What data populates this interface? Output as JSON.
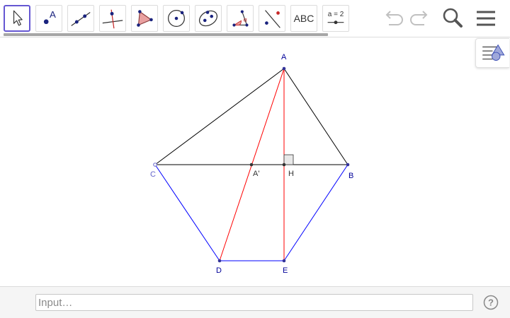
{
  "toolbar": {
    "tools": [
      {
        "name": "move-tool",
        "active": true
      },
      {
        "name": "point-tool",
        "icon_label": "A"
      },
      {
        "name": "line-tool"
      },
      {
        "name": "perpendicular-line-tool"
      },
      {
        "name": "polygon-tool"
      },
      {
        "name": "circle-with-center-tool"
      },
      {
        "name": "ellipse-tool"
      },
      {
        "name": "angle-tool",
        "icon_label": "α"
      },
      {
        "name": "reflect-about-line-tool"
      },
      {
        "name": "text-tool",
        "icon_label": "ABC"
      },
      {
        "name": "slider-tool",
        "icon_label": "a = 2"
      }
    ],
    "right_buttons": [
      "undo-icon",
      "redo-icon",
      "search-icon",
      "menu-icon"
    ]
  },
  "canvas": {
    "points": {
      "A": "A",
      "B": "B",
      "C": "C",
      "D": "D",
      "E": "E",
      "H": "H",
      "A_prime": "A'"
    },
    "colors": {
      "black_segments": "#000000",
      "blue_segments": "#0000ff",
      "red_segments": "#ff0000",
      "point_fill": "#333399",
      "label_dark_blue": "#000099",
      "label_violet": "#6666cc",
      "label_dark": "#333333"
    }
  },
  "input_bar": {
    "placeholder": "Input…"
  },
  "colors": {
    "active_tool_border": "#6557d2",
    "polygon_fill": "#e9a0a0",
    "icon_blue": "#1a237e"
  }
}
